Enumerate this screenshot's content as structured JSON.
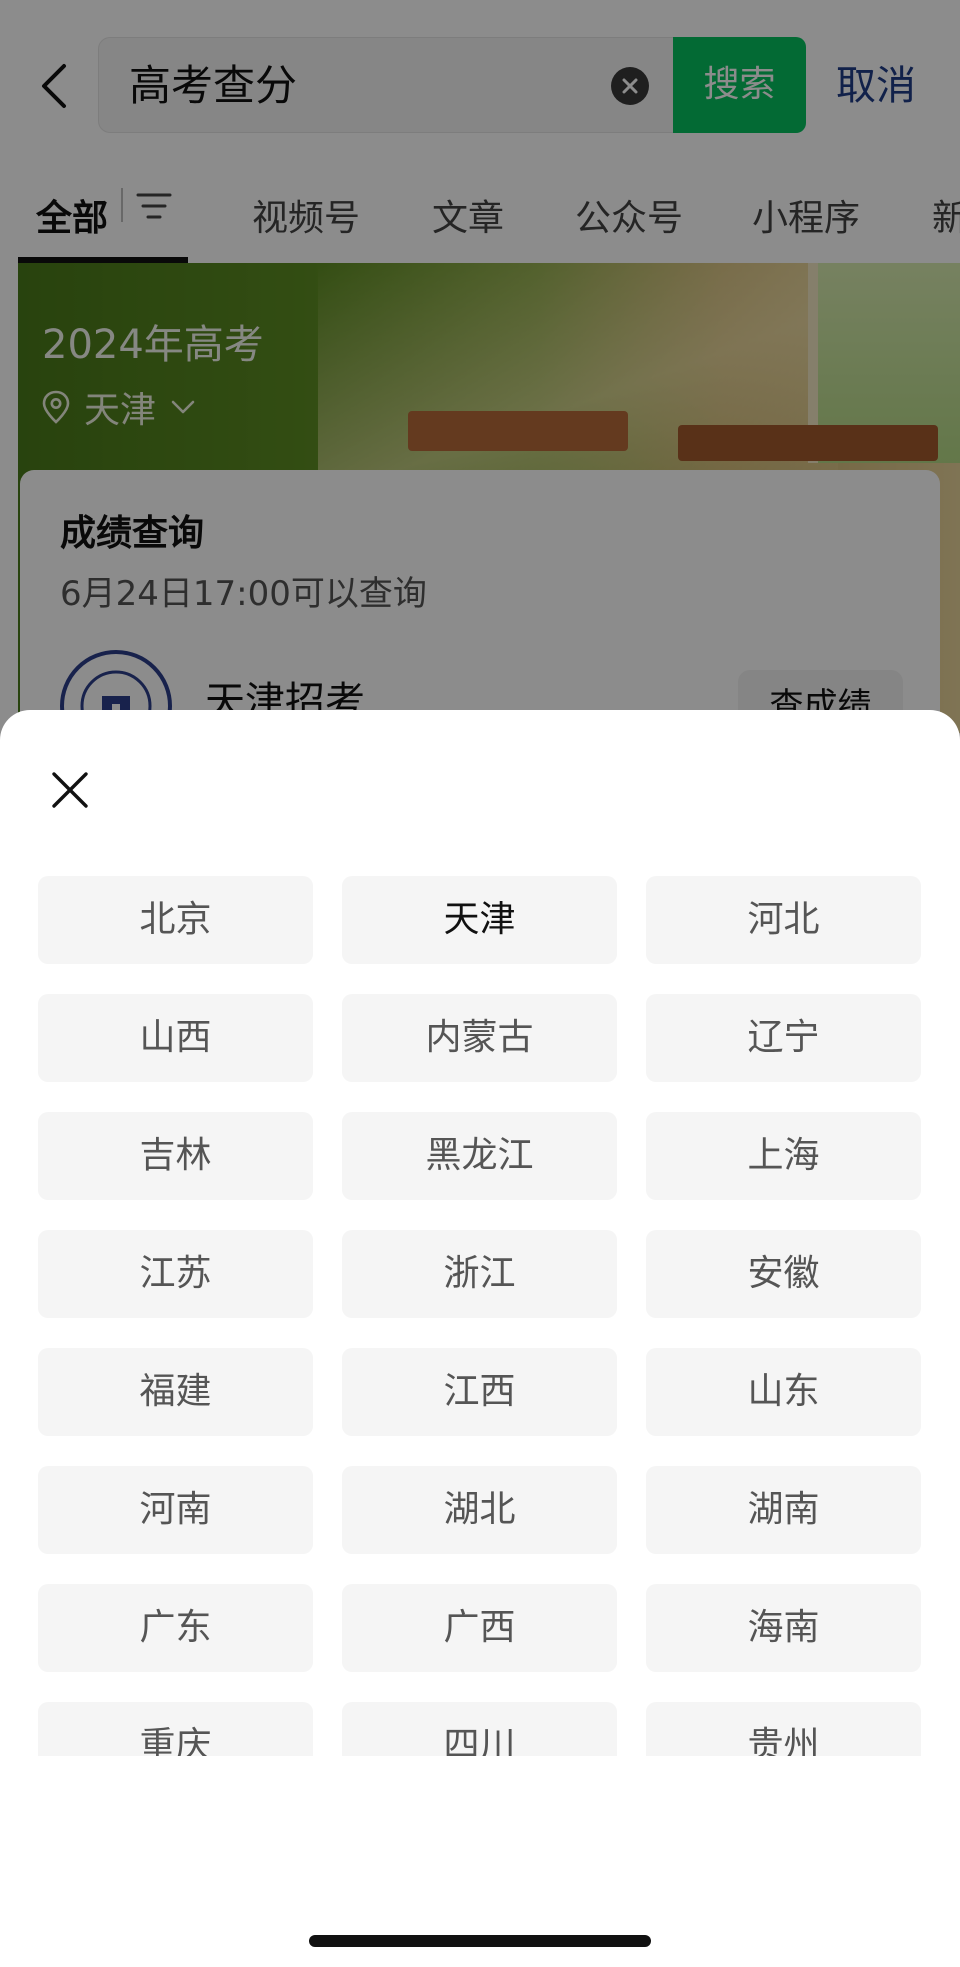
{
  "search": {
    "query": "高考查分",
    "search_button": "搜索",
    "cancel": "取消"
  },
  "tabs": [
    {
      "label": "全部",
      "active": true
    },
    {
      "label": "视频号",
      "active": false
    },
    {
      "label": "文章",
      "active": false
    },
    {
      "label": "公众号",
      "active": false
    },
    {
      "label": "小程序",
      "active": false
    },
    {
      "label": "新",
      "active": false
    }
  ],
  "banner": {
    "year_title": "2024年高考",
    "location": "天津"
  },
  "card": {
    "title": "成绩查询",
    "subtitle": "6月24日17:00可以查询",
    "org_name": "天津招考",
    "action": "查成绩"
  },
  "sheet": {
    "selected": "天津",
    "provinces": [
      "北京",
      "天津",
      "河北",
      "山西",
      "内蒙古",
      "辽宁",
      "吉林",
      "黑龙江",
      "上海",
      "江苏",
      "浙江",
      "安徽",
      "福建",
      "江西",
      "山东",
      "河南",
      "湖北",
      "湖南",
      "广东",
      "广西",
      "海南",
      "重庆",
      "四川",
      "贵州"
    ]
  },
  "colors": {
    "accent_green": "#07c160",
    "link_blue": "#1f3c88"
  }
}
